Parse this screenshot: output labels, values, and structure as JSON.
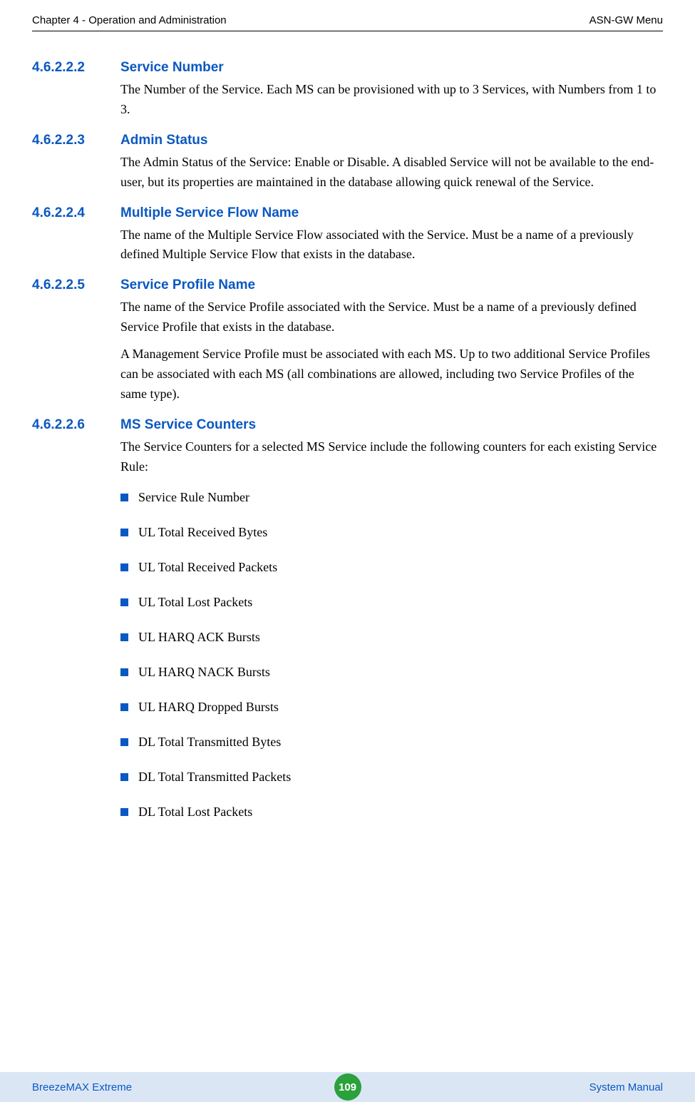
{
  "header": {
    "left": "Chapter 4 - Operation and Administration",
    "right": "ASN-GW Menu"
  },
  "sections": [
    {
      "num": "4.6.2.2.2",
      "title": "Service Number",
      "paras": [
        "The Number of the Service. Each MS can be provisioned with up to 3 Services, with Numbers from 1 to 3."
      ]
    },
    {
      "num": "4.6.2.2.3",
      "title": "Admin Status",
      "paras": [
        "The Admin Status of the Service: Enable or Disable. A disabled Service will not be available to the end-user, but its properties are maintained in the database allowing quick renewal of the Service."
      ]
    },
    {
      "num": "4.6.2.2.4",
      "title": "Multiple Service Flow Name",
      "paras": [
        "The name of the Multiple Service Flow associated with the Service. Must be a name of a previously defined Multiple Service Flow that exists in the database."
      ]
    },
    {
      "num": "4.6.2.2.5",
      "title": "Service Profile Name",
      "paras": [
        "The name of the Service Profile associated with the Service. Must be a name of a previously defined Service Profile that exists in the database.",
        "A Management Service Profile must be associated with each MS. Up to two additional Service Profiles can be associated with each MS (all combinations are allowed, including two Service Profiles of the same type)."
      ]
    },
    {
      "num": "4.6.2.2.6",
      "title": "MS Service Counters",
      "paras": [
        "The Service Counters for a selected MS Service include the following counters for each existing Service Rule:"
      ]
    }
  ],
  "bullets": [
    "Service Rule Number",
    "UL Total Received Bytes",
    "UL Total Received Packets",
    "UL Total Lost Packets",
    "UL HARQ ACK Bursts",
    "UL HARQ NACK Bursts",
    "UL HARQ Dropped Bursts",
    "DL Total Transmitted Bytes",
    "DL Total Transmitted Packets",
    "DL Total Lost Packets"
  ],
  "footer": {
    "left": "BreezeMAX Extreme",
    "page": "109",
    "right": "System Manual"
  }
}
